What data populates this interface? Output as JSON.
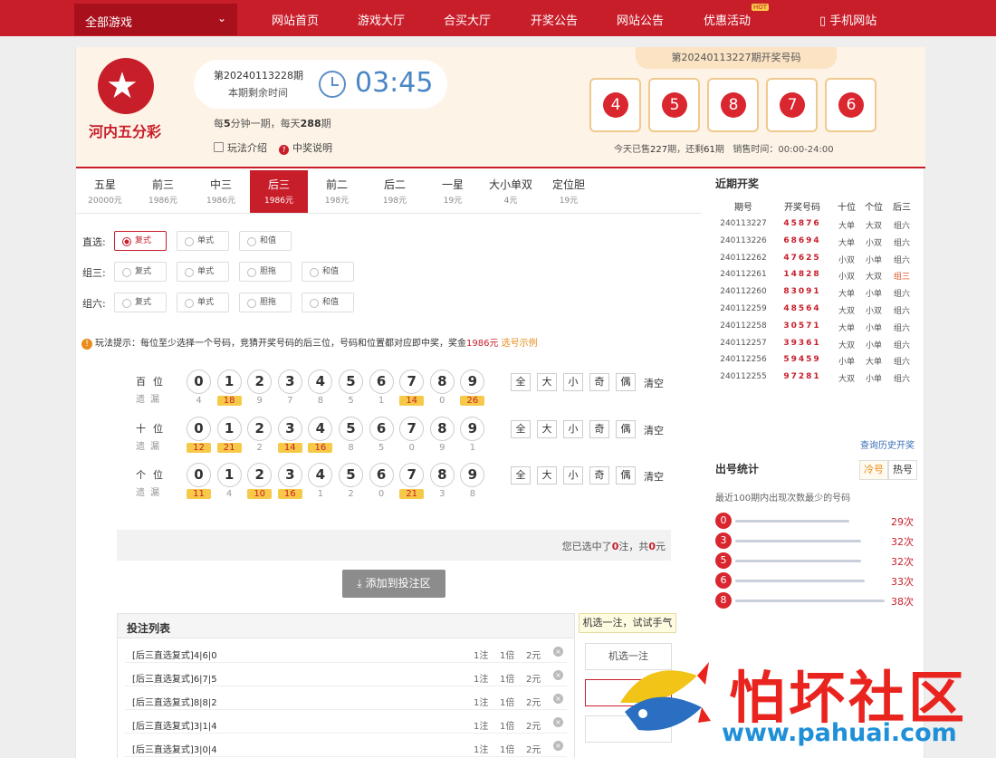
{
  "nav": {
    "games_label": "全部游戏",
    "items": [
      "网站首页",
      "游戏大厅",
      "合买大厅",
      "开奖公告",
      "网站公告",
      "优惠活动"
    ],
    "hot_badge": "HOT",
    "mobile": "手机网站"
  },
  "game": {
    "name": "河内五分彩",
    "period_label": "第20240113228期",
    "remain_label": "本期剩余时间",
    "countdown": "03:45",
    "per_day": {
      "p1": "每",
      "n1": "5",
      "p2": "分钟一期，每天",
      "n2": "288",
      "p3": "期"
    },
    "help1": "玩法介绍",
    "help2": "中奖说明"
  },
  "last_draw": {
    "label": "第20240113227期开奖号码",
    "balls": [
      "4",
      "5",
      "8",
      "7",
      "6"
    ],
    "sold": {
      "p1": "今天已售",
      "n1": "227",
      "p2": "期，还剩",
      "n2": "61",
      "p3": "期",
      "time": "销售时间：00:00-24:00"
    }
  },
  "tabs": [
    {
      "name": "五星",
      "prize": "20000元"
    },
    {
      "name": "前三",
      "prize": "1986元"
    },
    {
      "name": "中三",
      "prize": "1986元"
    },
    {
      "name": "后三",
      "prize": "1986元"
    },
    {
      "name": "前二",
      "prize": "198元"
    },
    {
      "name": "后二",
      "prize": "198元"
    },
    {
      "name": "一星",
      "prize": "19元"
    },
    {
      "name": "大小单双",
      "prize": "4元"
    },
    {
      "name": "定位胆",
      "prize": "19元"
    }
  ],
  "options": {
    "row1": {
      "label": "直选:",
      "opts": [
        "复式",
        "单式",
        "和值"
      ]
    },
    "row2": {
      "label": "组三:",
      "opts": [
        "复式",
        "单式",
        "胆拖",
        "和值"
      ]
    },
    "row3": {
      "label": "组六:",
      "opts": [
        "复式",
        "单式",
        "胆拖",
        "和值"
      ]
    }
  },
  "tip": {
    "text": "玩法提示：每位至少选择一个号码，竞猜开奖号码的后三位，号码和位置都对应即中奖，奖金",
    "prize": "1986元",
    "link": "选号示例"
  },
  "positions": [
    {
      "label": "百位",
      "sub": "遗漏",
      "miss": [
        "4",
        "18",
        "9",
        "7",
        "8",
        "5",
        "1",
        "14",
        "0",
        "26"
      ]
    },
    {
      "label": "十位",
      "sub": "遗漏",
      "miss": [
        "12",
        "21",
        "2",
        "14",
        "16",
        "8",
        "5",
        "0",
        "9",
        "1"
      ]
    },
    {
      "label": "个位",
      "sub": "遗漏",
      "miss": [
        "11",
        "4",
        "10",
        "16",
        "1",
        "2",
        "0",
        "21",
        "3",
        "8"
      ]
    }
  ],
  "digits": [
    "0",
    "1",
    "2",
    "3",
    "4",
    "5",
    "6",
    "7",
    "8",
    "9"
  ],
  "quick": [
    "全",
    "大",
    "小",
    "奇",
    "偶"
  ],
  "clear_label": "清空",
  "summary": {
    "p1": "您已选中了",
    "n1": "0",
    "p2": "注，共",
    "n2": "0",
    "p3": "元"
  },
  "add_button": "添加到投注区",
  "betlist": {
    "title": "投注列表",
    "rows": [
      {
        "type": "[后三直选复式]",
        "nums": "4|6|0",
        "zhu": "1注",
        "bei": "1倍",
        "yuan": "2元"
      },
      {
        "type": "[后三直选复式]",
        "nums": "6|7|5",
        "zhu": "1注",
        "bei": "1倍",
        "yuan": "2元"
      },
      {
        "type": "[后三直选复式]",
        "nums": "8|8|2",
        "zhu": "1注",
        "bei": "1倍",
        "yuan": "2元"
      },
      {
        "type": "[后三直选复式]",
        "nums": "3|1|4",
        "zhu": "1注",
        "bei": "1倍",
        "yuan": "2元"
      },
      {
        "type": "[后三直选复式]",
        "nums": "3|0|4",
        "zhu": "1注",
        "bei": "1倍",
        "yuan": "2元"
      }
    ]
  },
  "random_tip": "机选一注，试试手气",
  "random_btn": "机选一注",
  "recent": {
    "title": "近期开奖",
    "headers": [
      "期号",
      "开奖号码",
      "十位",
      "个位",
      "后三"
    ],
    "rows": [
      [
        "240113227",
        "45876",
        "大单",
        "大双",
        "组六"
      ],
      [
        "240113226",
        "68694",
        "大单",
        "小双",
        "组六"
      ],
      [
        "240112262",
        "47625",
        "小双",
        "小单",
        "组六"
      ],
      [
        "240112261",
        "14828",
        "小双",
        "大双",
        "组三"
      ],
      [
        "240112260",
        "83091",
        "大单",
        "小单",
        "组六"
      ],
      [
        "240112259",
        "48564",
        "大双",
        "小双",
        "组六"
      ],
      [
        "240112258",
        "30571",
        "大单",
        "小单",
        "组六"
      ],
      [
        "240112257",
        "39361",
        "大双",
        "小单",
        "组六"
      ],
      [
        "240112256",
        "59459",
        "小单",
        "大单",
        "组六"
      ],
      [
        "240112255",
        "97281",
        "大双",
        "小单",
        "组六"
      ]
    ],
    "more": "查询历史开奖"
  },
  "stats": {
    "title": "出号统计",
    "tab_cold": "冷号",
    "tab_hot": "热号",
    "desc": "最近100期内出现次数最少的号码",
    "rows": [
      {
        "ball": "0",
        "count": "29次",
        "level": 29
      },
      {
        "ball": "3",
        "count": "32次",
        "level": 32
      },
      {
        "ball": "5",
        "count": "32次",
        "level": 32
      },
      {
        "ball": "6",
        "count": "33次",
        "level": 33
      },
      {
        "ball": "8",
        "count": "38次",
        "level": 38
      }
    ]
  },
  "watermark": {
    "text": "怕坏社区",
    "url": "www.pahuai.com"
  }
}
